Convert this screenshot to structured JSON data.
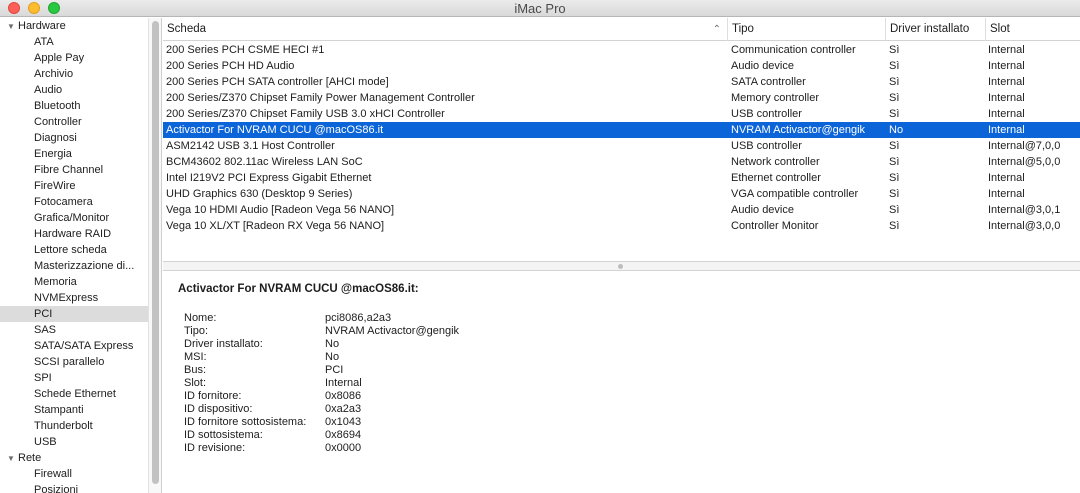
{
  "window": {
    "title": "iMac Pro"
  },
  "sidebar": {
    "groups": [
      {
        "label": "Hardware",
        "items": [
          "ATA",
          "Apple Pay",
          "Archivio",
          "Audio",
          "Bluetooth",
          "Controller",
          "Diagnosi",
          "Energia",
          "Fibre Channel",
          "FireWire",
          "Fotocamera",
          "Grafica/Monitor",
          "Hardware RAID",
          "Lettore scheda",
          "Masterizzazione di...",
          "Memoria",
          "NVMExpress",
          "PCI",
          "SAS",
          "SATA/SATA Express",
          "SCSI parallelo",
          "SPI",
          "Schede Ethernet",
          "Stampanti",
          "Thunderbolt",
          "USB"
        ]
      },
      {
        "label": "Rete",
        "items": [
          "Firewall",
          "Posizioni"
        ]
      }
    ],
    "selected": "PCI"
  },
  "table": {
    "columns": [
      "Scheda",
      "Tipo",
      "Driver installato",
      "Slot"
    ],
    "rows": [
      [
        "200 Series PCH CSME HECI #1",
        "Communication controller",
        "Sì",
        "Internal"
      ],
      [
        "200 Series PCH HD Audio",
        "Audio device",
        "Sì",
        "Internal"
      ],
      [
        "200 Series PCH SATA controller [AHCI mode]",
        "SATA controller",
        "Sì",
        "Internal"
      ],
      [
        "200 Series/Z370 Chipset Family Power Management Controller",
        "Memory controller",
        "Sì",
        "Internal"
      ],
      [
        "200 Series/Z370 Chipset Family USB 3.0 xHCI Controller",
        "USB controller",
        "Sì",
        "Internal"
      ],
      [
        "Activactor For NVRAM CUCU @macOS86.it",
        "NVRAM Activactor@gengik",
        "No",
        "Internal"
      ],
      [
        "ASM2142 USB 3.1 Host Controller",
        "USB controller",
        "Sì",
        "Internal@7,0,0"
      ],
      [
        "BCM43602 802.11ac Wireless LAN SoC",
        "Network controller",
        "Sì",
        "Internal@5,0,0"
      ],
      [
        "Intel I219V2 PCI Express Gigabit Ethernet",
        "Ethernet controller",
        "Sì",
        "Internal"
      ],
      [
        "UHD Graphics 630 (Desktop 9 Series)",
        "VGA compatible controller",
        "Sì",
        "Internal"
      ],
      [
        "Vega 10 HDMI Audio [Radeon Vega 56 NANO]",
        "Audio device",
        "Sì",
        "Internal@3,0,1"
      ],
      [
        "Vega 10 XL/XT [Radeon RX Vega 56 NANO]",
        "Controller Monitor",
        "Sì",
        "Internal@3,0,0"
      ]
    ],
    "selected_row": 5
  },
  "detail": {
    "title": "Activactor For NVRAM CUCU @macOS86.it:",
    "properties": [
      {
        "key": "Nome:",
        "value": "pci8086,a2a3"
      },
      {
        "key": "Tipo:",
        "value": "NVRAM Activactor@gengik"
      },
      {
        "key": "Driver installato:",
        "value": "No"
      },
      {
        "key": "MSI:",
        "value": "No"
      },
      {
        "key": "Bus:",
        "value": "PCI"
      },
      {
        "key": "Slot:",
        "value": "Internal"
      },
      {
        "key": "ID fornitore:",
        "value": "0x8086"
      },
      {
        "key": "ID dispositivo:",
        "value": "0xa2a3"
      },
      {
        "key": "ID fornitore sottosistema:",
        "value": "0x1043"
      },
      {
        "key": "ID sottosistema:",
        "value": "0x8694"
      },
      {
        "key": "ID revisione:",
        "value": "0x0000"
      }
    ]
  },
  "colors": {
    "selection": "#0b64d8",
    "sidebar_selection": "#dcdcdc",
    "close": "#fc5f57",
    "minimize": "#fdbc2e",
    "maximize": "#28c840"
  }
}
